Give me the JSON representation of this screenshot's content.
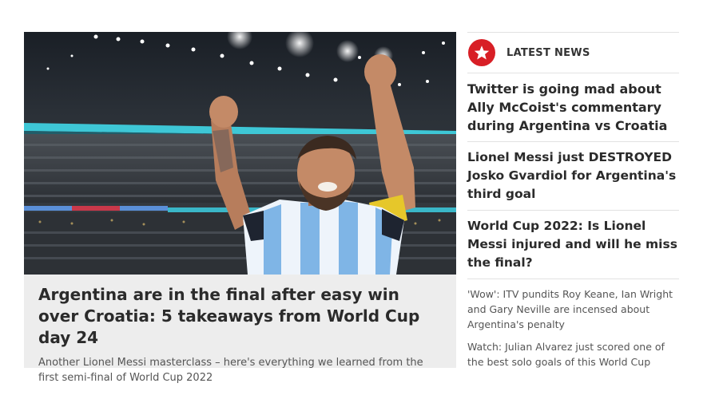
{
  "hero": {
    "title": "Argentina are in the final after easy win over Croatia: 5 takeaways from World Cup day 24",
    "summary": "Another Lionel Messi masterclass – here's everything we learned from the first semi-final of World Cup 2022",
    "image_alt": "Lionel Messi celebrating with both fists raised"
  },
  "sidebar": {
    "title": "LATEST NEWS",
    "icon": "star-icon",
    "accent_color": "#d81f26",
    "headlines": [
      {
        "text": "Twitter is going mad about Ally McCoist's commentary during Argentina vs Croatia",
        "style": "big"
      },
      {
        "text": "Lionel Messi just DESTROYED Josko Gvardiol for Argentina's third goal",
        "style": "big"
      },
      {
        "text": "World Cup 2022: Is Lionel Messi injured and will he miss the final?",
        "style": "big"
      },
      {
        "text": "'Wow': ITV pundits Roy Keane, Ian Wright and Gary Neville are incensed about Argentina's penalty",
        "style": "small"
      },
      {
        "text": "Watch: Julian Alvarez just scored one of the best solo goals of this World Cup",
        "style": "small"
      }
    ]
  }
}
